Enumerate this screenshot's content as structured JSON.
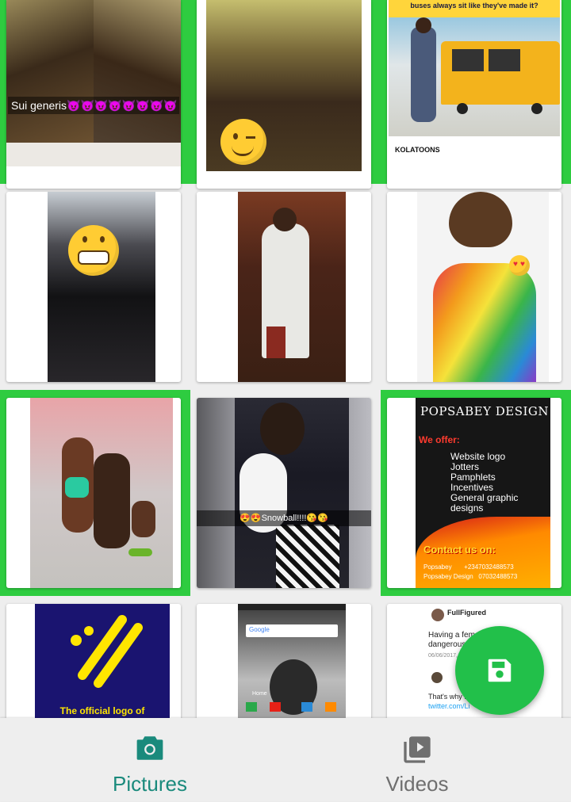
{
  "colors": {
    "selection": "#2ecc40",
    "accent_active": "#1a8a7c",
    "inactive": "#6f6f6f",
    "fab": "#22c04a"
  },
  "grid": {
    "items": [
      {
        "caption": "Sui generis😈😈😈😈😈😈😈😈",
        "selected": true
      },
      {
        "selected": true
      },
      {
        "overlay_text": "buses always sit like they've made it?",
        "footer_text": "KOLATOONS",
        "selected": true
      },
      {
        "selected": false
      },
      {
        "selected": false
      },
      {
        "selected": false
      },
      {
        "selected": true
      },
      {
        "caption": "😍😍Snowball!!!!😘😘",
        "selected": false
      },
      {
        "selected": true,
        "poster": {
          "title": "POPSABEY DESIGN",
          "offer_heading": "We offer:",
          "offers": [
            "Website logo",
            "Jotters",
            "Pamphlets",
            "Incentives",
            "General graphic designs"
          ],
          "contact_heading": "Contact us on:",
          "contact_lines": [
            "Popsabey",
            "+2347032488573",
            "Popsabey Design",
            "07032488573"
          ]
        }
      },
      {
        "selected": false,
        "caption": "The official logo of"
      },
      {
        "selected": false,
        "search_label": "Google",
        "home_label": "Home"
      },
      {
        "selected": false,
        "tweet": {
          "name": "FullFigured",
          "line1": "Having a female",
          "line2": "dangerous thi",
          "date": "06/06/2017, 1",
          "line3": "That's why I",
          "link": "twitter.com/Li"
        }
      }
    ]
  },
  "fab": {
    "icon": "save-icon"
  },
  "bottom_nav": {
    "items": [
      {
        "label": "Pictures",
        "icon": "camera-icon",
        "active": true
      },
      {
        "label": "Videos",
        "icon": "video-library-icon",
        "active": false
      }
    ]
  }
}
